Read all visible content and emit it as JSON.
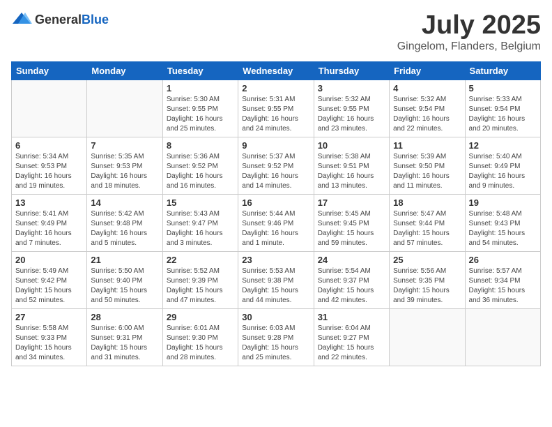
{
  "header": {
    "logo_general": "General",
    "logo_blue": "Blue",
    "month": "July 2025",
    "location": "Gingelom, Flanders, Belgium"
  },
  "weekdays": [
    "Sunday",
    "Monday",
    "Tuesday",
    "Wednesday",
    "Thursday",
    "Friday",
    "Saturday"
  ],
  "weeks": [
    [
      {
        "day": "",
        "sunrise": "",
        "sunset": "",
        "daylight": ""
      },
      {
        "day": "",
        "sunrise": "",
        "sunset": "",
        "daylight": ""
      },
      {
        "day": "1",
        "sunrise": "Sunrise: 5:30 AM",
        "sunset": "Sunset: 9:55 PM",
        "daylight": "Daylight: 16 hours and 25 minutes."
      },
      {
        "day": "2",
        "sunrise": "Sunrise: 5:31 AM",
        "sunset": "Sunset: 9:55 PM",
        "daylight": "Daylight: 16 hours and 24 minutes."
      },
      {
        "day": "3",
        "sunrise": "Sunrise: 5:32 AM",
        "sunset": "Sunset: 9:55 PM",
        "daylight": "Daylight: 16 hours and 23 minutes."
      },
      {
        "day": "4",
        "sunrise": "Sunrise: 5:32 AM",
        "sunset": "Sunset: 9:54 PM",
        "daylight": "Daylight: 16 hours and 22 minutes."
      },
      {
        "day": "5",
        "sunrise": "Sunrise: 5:33 AM",
        "sunset": "Sunset: 9:54 PM",
        "daylight": "Daylight: 16 hours and 20 minutes."
      }
    ],
    [
      {
        "day": "6",
        "sunrise": "Sunrise: 5:34 AM",
        "sunset": "Sunset: 9:53 PM",
        "daylight": "Daylight: 16 hours and 19 minutes."
      },
      {
        "day": "7",
        "sunrise": "Sunrise: 5:35 AM",
        "sunset": "Sunset: 9:53 PM",
        "daylight": "Daylight: 16 hours and 18 minutes."
      },
      {
        "day": "8",
        "sunrise": "Sunrise: 5:36 AM",
        "sunset": "Sunset: 9:52 PM",
        "daylight": "Daylight: 16 hours and 16 minutes."
      },
      {
        "day": "9",
        "sunrise": "Sunrise: 5:37 AM",
        "sunset": "Sunset: 9:52 PM",
        "daylight": "Daylight: 16 hours and 14 minutes."
      },
      {
        "day": "10",
        "sunrise": "Sunrise: 5:38 AM",
        "sunset": "Sunset: 9:51 PM",
        "daylight": "Daylight: 16 hours and 13 minutes."
      },
      {
        "day": "11",
        "sunrise": "Sunrise: 5:39 AM",
        "sunset": "Sunset: 9:50 PM",
        "daylight": "Daylight: 16 hours and 11 minutes."
      },
      {
        "day": "12",
        "sunrise": "Sunrise: 5:40 AM",
        "sunset": "Sunset: 9:49 PM",
        "daylight": "Daylight: 16 hours and 9 minutes."
      }
    ],
    [
      {
        "day": "13",
        "sunrise": "Sunrise: 5:41 AM",
        "sunset": "Sunset: 9:49 PM",
        "daylight": "Daylight: 16 hours and 7 minutes."
      },
      {
        "day": "14",
        "sunrise": "Sunrise: 5:42 AM",
        "sunset": "Sunset: 9:48 PM",
        "daylight": "Daylight: 16 hours and 5 minutes."
      },
      {
        "day": "15",
        "sunrise": "Sunrise: 5:43 AM",
        "sunset": "Sunset: 9:47 PM",
        "daylight": "Daylight: 16 hours and 3 minutes."
      },
      {
        "day": "16",
        "sunrise": "Sunrise: 5:44 AM",
        "sunset": "Sunset: 9:46 PM",
        "daylight": "Daylight: 16 hours and 1 minute."
      },
      {
        "day": "17",
        "sunrise": "Sunrise: 5:45 AM",
        "sunset": "Sunset: 9:45 PM",
        "daylight": "Daylight: 15 hours and 59 minutes."
      },
      {
        "day": "18",
        "sunrise": "Sunrise: 5:47 AM",
        "sunset": "Sunset: 9:44 PM",
        "daylight": "Daylight: 15 hours and 57 minutes."
      },
      {
        "day": "19",
        "sunrise": "Sunrise: 5:48 AM",
        "sunset": "Sunset: 9:43 PM",
        "daylight": "Daylight: 15 hours and 54 minutes."
      }
    ],
    [
      {
        "day": "20",
        "sunrise": "Sunrise: 5:49 AM",
        "sunset": "Sunset: 9:42 PM",
        "daylight": "Daylight: 15 hours and 52 minutes."
      },
      {
        "day": "21",
        "sunrise": "Sunrise: 5:50 AM",
        "sunset": "Sunset: 9:40 PM",
        "daylight": "Daylight: 15 hours and 50 minutes."
      },
      {
        "day": "22",
        "sunrise": "Sunrise: 5:52 AM",
        "sunset": "Sunset: 9:39 PM",
        "daylight": "Daylight: 15 hours and 47 minutes."
      },
      {
        "day": "23",
        "sunrise": "Sunrise: 5:53 AM",
        "sunset": "Sunset: 9:38 PM",
        "daylight": "Daylight: 15 hours and 44 minutes."
      },
      {
        "day": "24",
        "sunrise": "Sunrise: 5:54 AM",
        "sunset": "Sunset: 9:37 PM",
        "daylight": "Daylight: 15 hours and 42 minutes."
      },
      {
        "day": "25",
        "sunrise": "Sunrise: 5:56 AM",
        "sunset": "Sunset: 9:35 PM",
        "daylight": "Daylight: 15 hours and 39 minutes."
      },
      {
        "day": "26",
        "sunrise": "Sunrise: 5:57 AM",
        "sunset": "Sunset: 9:34 PM",
        "daylight": "Daylight: 15 hours and 36 minutes."
      }
    ],
    [
      {
        "day": "27",
        "sunrise": "Sunrise: 5:58 AM",
        "sunset": "Sunset: 9:33 PM",
        "daylight": "Daylight: 15 hours and 34 minutes."
      },
      {
        "day": "28",
        "sunrise": "Sunrise: 6:00 AM",
        "sunset": "Sunset: 9:31 PM",
        "daylight": "Daylight: 15 hours and 31 minutes."
      },
      {
        "day": "29",
        "sunrise": "Sunrise: 6:01 AM",
        "sunset": "Sunset: 9:30 PM",
        "daylight": "Daylight: 15 hours and 28 minutes."
      },
      {
        "day": "30",
        "sunrise": "Sunrise: 6:03 AM",
        "sunset": "Sunset: 9:28 PM",
        "daylight": "Daylight: 15 hours and 25 minutes."
      },
      {
        "day": "31",
        "sunrise": "Sunrise: 6:04 AM",
        "sunset": "Sunset: 9:27 PM",
        "daylight": "Daylight: 15 hours and 22 minutes."
      },
      {
        "day": "",
        "sunrise": "",
        "sunset": "",
        "daylight": ""
      },
      {
        "day": "",
        "sunrise": "",
        "sunset": "",
        "daylight": ""
      }
    ]
  ]
}
